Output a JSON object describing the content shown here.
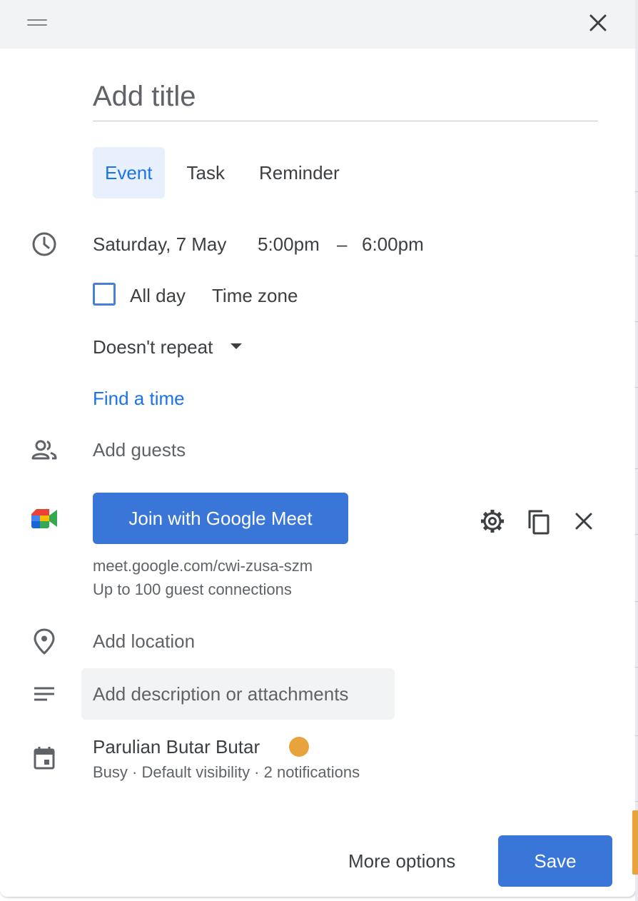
{
  "title_field": {
    "placeholder": "Add title",
    "value": ""
  },
  "tabs": [
    {
      "label": "Event",
      "active": true
    },
    {
      "label": "Task",
      "active": false
    },
    {
      "label": "Reminder",
      "active": false
    }
  ],
  "datetime": {
    "date": "Saturday, 7 May",
    "start_time": "5:00pm",
    "separator": "–",
    "end_time": "6:00pm",
    "all_day_label": "All day",
    "all_day_checked": false,
    "time_zone_label": "Time zone",
    "repeat_label": "Doesn't repeat"
  },
  "find_time_label": "Find a time",
  "guests": {
    "placeholder": "Add guests"
  },
  "meet": {
    "button_label": "Join with Google Meet",
    "link": "meet.google.com/cwi-zusa-szm",
    "capacity": "Up to 100 guest connections"
  },
  "location": {
    "placeholder": "Add location"
  },
  "description": {
    "placeholder": "Add description or attachments"
  },
  "calendar": {
    "owner": "Parulian Butar Butar",
    "color": "#e8a33d",
    "details": "Busy · Default visibility · 2 notifications"
  },
  "footer": {
    "more_options_label": "More options",
    "save_label": "Save"
  },
  "colors": {
    "accent": "#1a73e8",
    "button": "#3a76d8",
    "tab_active_bg": "#e8f0fe"
  },
  "icons": [
    "drag-handle-icon",
    "close-icon",
    "clock-icon",
    "people-icon",
    "google-meet-icon",
    "gear-icon",
    "copy-icon",
    "remove-conference-icon",
    "location-pin-icon",
    "notes-icon",
    "calendar-icon",
    "dropdown-arrow-icon"
  ]
}
